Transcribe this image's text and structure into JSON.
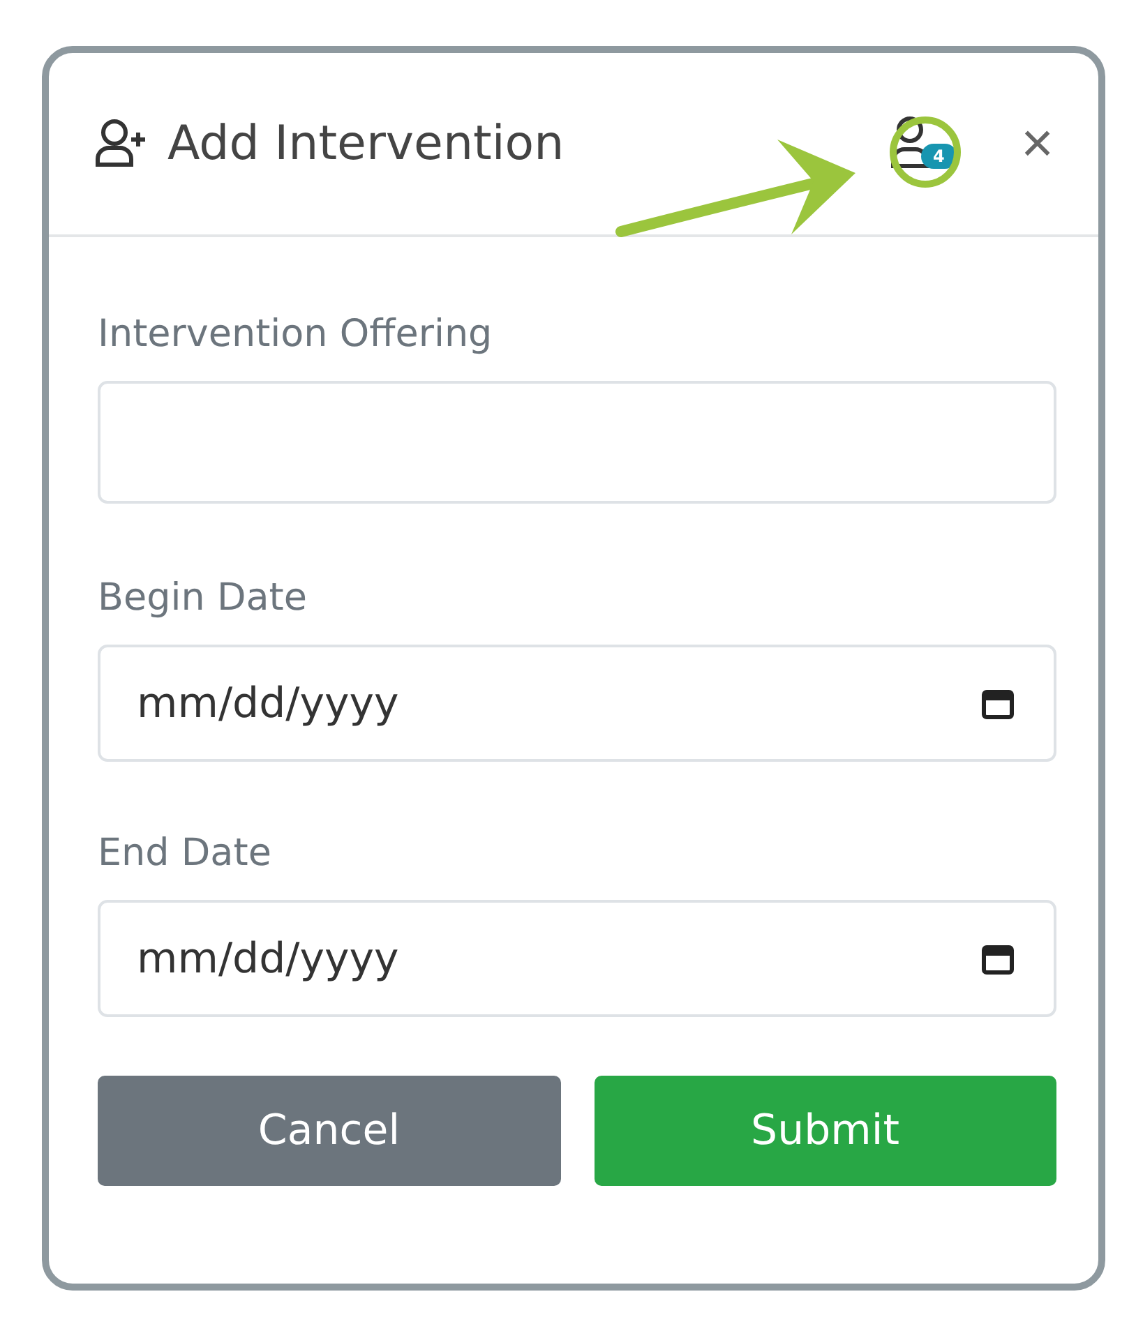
{
  "dialog": {
    "title": "Add Intervention",
    "badge": "4",
    "close": "×"
  },
  "fields": [
    {
      "kind": "text",
      "label": "Intervention Offering"
    },
    {
      "kind": "date",
      "label": "Begin Date",
      "placeholder": "mm/dd/yyyy"
    },
    {
      "kind": "date",
      "label": "End Date",
      "placeholder": "mm/dd/yyyy"
    }
  ],
  "buttons": [
    {
      "kind": "secondary",
      "label": "Cancel"
    },
    {
      "kind": "primary",
      "label": "Submit"
    }
  ]
}
